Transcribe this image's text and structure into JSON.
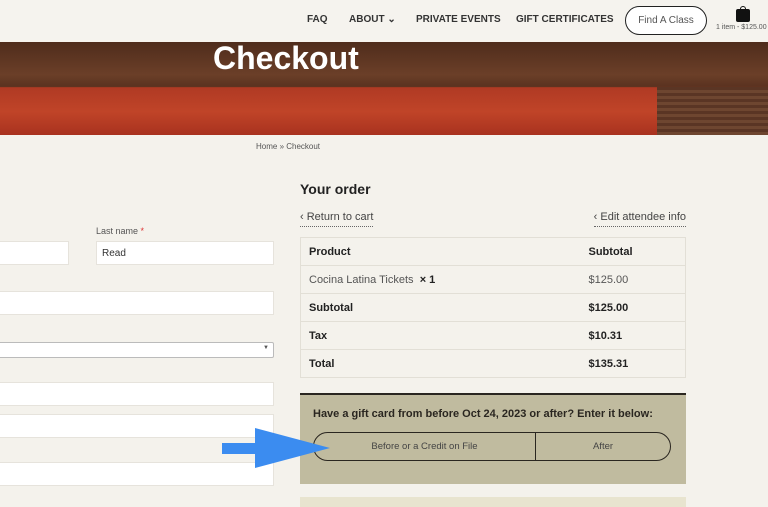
{
  "nav": {
    "items": [
      "FAQ",
      "ABOUT",
      "PRIVATE EVENTS",
      "GIFT CERTIFICATES"
    ],
    "find_class": "Find A Class",
    "cart_summary": "1 item - $125.00"
  },
  "hero": {
    "title": "Checkout"
  },
  "breadcrumb": "Home » Checkout",
  "form": {
    "last_name_label": "Last name",
    "required_mark": "*",
    "last_name_value": "Read"
  },
  "order": {
    "title": "Your order",
    "return_link": "Return to cart",
    "edit_link": "Edit attendee info",
    "headers": [
      "Product",
      "Subtotal"
    ],
    "item": {
      "name": "Cocina Latina Tickets",
      "qty": "× 1",
      "price": "$125.00"
    },
    "rows": [
      {
        "label": "Subtotal",
        "value": "$125.00"
      },
      {
        "label": "Tax",
        "value": "$10.31"
      },
      {
        "label": "Total",
        "value": "$135.31"
      }
    ]
  },
  "gift": {
    "prompt": "Have a gift card from before Oct 24, 2023 or after? Enter it below:",
    "option_before": "Before or a Credit on File",
    "option_after": "After"
  },
  "colors": {
    "arrow": "#3b8cf0",
    "gift_bg": "#c0bb9f"
  }
}
